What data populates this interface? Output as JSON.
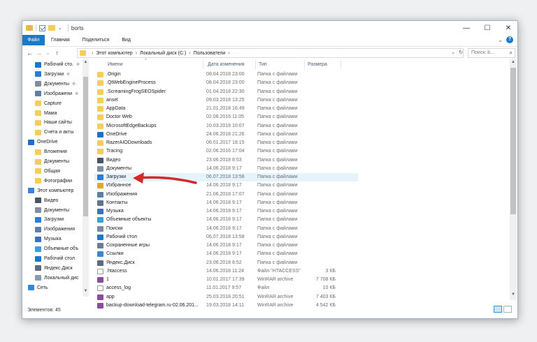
{
  "window": {
    "title": "borts",
    "controls": {
      "minimize": "—",
      "maximize": "☐",
      "close": "✕"
    }
  },
  "ribbon": {
    "tabs": [
      "Файл",
      "Главная",
      "Поделиться",
      "Вид"
    ],
    "expand": "⌄",
    "help": "?"
  },
  "address": {
    "back": "←",
    "forward": "→",
    "recent": "⌄",
    "up": "↑",
    "crumbs": [
      "Этот компьютер",
      "Локальный диск (C:)",
      "Пользователи",
      "·····"
    ],
    "dropdown": "⌄",
    "refresh": "↻",
    "search_placeholder": "Поиск: b...",
    "search_icon": "⌕"
  },
  "navpane": {
    "pin": "✲",
    "items": [
      {
        "label": "Рабочий сто.",
        "icon": "desktop-icon",
        "color": "#1979ca",
        "pinned": true,
        "indent": 1
      },
      {
        "label": "Загрузки",
        "icon": "download-icon",
        "color": "#2c7bd6",
        "pinned": true,
        "indent": 1
      },
      {
        "label": "Документы",
        "icon": "documents-icon",
        "color": "#7f8ea3",
        "pinned": true,
        "indent": 1
      },
      {
        "label": "Изображени",
        "icon": "pictures-icon",
        "color": "#5c7fa8",
        "pinned": true,
        "indent": 1
      },
      {
        "label": "Capture",
        "icon": "folder-icon",
        "color": "#f4ce5c",
        "pinned": false,
        "indent": 1
      },
      {
        "label": "Мама",
        "icon": "folder-icon",
        "color": "#f4ce5c",
        "pinned": false,
        "indent": 1
      },
      {
        "label": "Наши сайты",
        "icon": "folder-icon",
        "color": "#f4ce5c",
        "pinned": false,
        "indent": 1
      },
      {
        "label": "Счета и акты",
        "icon": "folder-icon",
        "color": "#f4ce5c",
        "pinned": false,
        "indent": 1
      },
      {
        "label": "OneDrive",
        "icon": "onedrive-icon",
        "color": "#1e6fc9",
        "pinned": false,
        "indent": 0
      },
      {
        "label": "Вложения",
        "icon": "folder-icon",
        "color": "#f4ce5c",
        "pinned": false,
        "indent": 1
      },
      {
        "label": "Документы",
        "icon": "folder-icon",
        "color": "#f4ce5c",
        "pinned": false,
        "indent": 1
      },
      {
        "label": "Общая",
        "icon": "folder-icon",
        "color": "#f4ce5c",
        "pinned": false,
        "indent": 1
      },
      {
        "label": "Фотографии",
        "icon": "folder-icon",
        "color": "#f4ce5c",
        "pinned": false,
        "indent": 1
      },
      {
        "label": "Этот компьютер",
        "icon": "computer-icon",
        "color": "#3a86d6",
        "pinned": false,
        "indent": 0
      },
      {
        "label": "Видео",
        "icon": "video-icon",
        "color": "#4a5668",
        "pinned": false,
        "indent": 1
      },
      {
        "label": "Документы",
        "icon": "documents-icon",
        "color": "#7f8ea3",
        "pinned": false,
        "indent": 1
      },
      {
        "label": "Загрузки",
        "icon": "download-icon",
        "color": "#2c7bd6",
        "pinned": false,
        "indent": 1
      },
      {
        "label": "Изображения",
        "icon": "pictures-icon",
        "color": "#5c7fa8",
        "pinned": false,
        "indent": 1
      },
      {
        "label": "Музыка",
        "icon": "music-icon",
        "color": "#3a6fc4",
        "pinned": false,
        "indent": 1
      },
      {
        "label": "Объемные объ",
        "icon": "3d-objects-icon",
        "color": "#3aa0d8",
        "pinned": false,
        "indent": 1
      },
      {
        "label": "Рабочий стол",
        "icon": "desktop-icon",
        "color": "#1979ca",
        "pinned": false,
        "indent": 1
      },
      {
        "label": "Яндекс.Диск",
        "icon": "yandex-disk-icon",
        "color": "#5b6b80",
        "pinned": false,
        "indent": 1
      },
      {
        "label": "Локальный дис",
        "icon": "drive-icon",
        "color": "#8a9bb0",
        "pinned": false,
        "indent": 1
      },
      {
        "label": "Сеть",
        "icon": "network-icon",
        "color": "#3a86d6",
        "pinned": false,
        "indent": 0
      }
    ]
  },
  "columns": {
    "name": "Имени",
    "date": "Дата изменения",
    "type": "Тип",
    "size": "Размера",
    "sort_indicator": "^"
  },
  "files": [
    {
      "name": ".Origin",
      "date": "08.04.2018 23:00",
      "type": "Папка с файлами",
      "size": "",
      "icon": "folder-icon",
      "color": "#f4ce5c"
    },
    {
      "name": ".QtWebEngineProcess",
      "date": "08.04.2018 23:00",
      "type": "Папка с файлами",
      "size": "",
      "icon": "folder-icon",
      "color": "#f4ce5c"
    },
    {
      "name": ".ScreamingFrogSEOSpider",
      "date": "01.04.2018 22:30",
      "type": "Папка с файлами",
      "size": "",
      "icon": "folder-icon",
      "color": "#f4ce5c"
    },
    {
      "name": "ansel",
      "date": "09.03.2018 13:25",
      "type": "Папка с файлами",
      "size": "",
      "icon": "folder-icon",
      "color": "#f4ce5c"
    },
    {
      "name": "AppData",
      "date": "21.01.2018 16:49",
      "type": "Папка с файлами",
      "size": "",
      "icon": "folder-icon",
      "color": "#f4ce5c"
    },
    {
      "name": "Doctor Web",
      "date": "02.08.2016 11:05",
      "type": "Папка с файлами",
      "size": "",
      "icon": "folder-icon",
      "color": "#f4ce5c"
    },
    {
      "name": "MicrosoftEdgeBackups",
      "date": "10.03.2018 10:07",
      "type": "Папка с файлами",
      "size": "",
      "icon": "folder-icon",
      "color": "#f4ce5c"
    },
    {
      "name": "OneDrive",
      "date": "24.06.2018 21:26",
      "type": "Папка с файлами",
      "size": "",
      "icon": "onedrive-icon",
      "color": "#1e6fc9"
    },
    {
      "name": "RazerAIODownloads",
      "date": "06.01.2017 18:15",
      "type": "Папка с файлами",
      "size": "",
      "icon": "folder-icon",
      "color": "#f4ce5c"
    },
    {
      "name": "Tracing",
      "date": "02.06.2016 17:04",
      "type": "Папка с файлами",
      "size": "",
      "icon": "folder-icon",
      "color": "#f4ce5c"
    },
    {
      "name": "Видео",
      "date": "23.06.2018 8:53",
      "type": "Папка с файлами",
      "size": "",
      "icon": "video-icon",
      "color": "#4a5668"
    },
    {
      "name": "Документы",
      "date": "14.06.2018 9:17",
      "type": "Папка с файлами",
      "size": "",
      "icon": "documents-icon",
      "color": "#7f8ea3"
    },
    {
      "name": "Загрузки",
      "date": "06.07.2018 13:58",
      "type": "Папка с файлами",
      "size": "",
      "icon": "download-icon",
      "color": "#2c7bd6",
      "selected": true
    },
    {
      "name": "Избранное",
      "date": "14.06.2018 9:17",
      "type": "Папка с файлами",
      "size": "",
      "icon": "favorites-icon",
      "color": "#e8a626"
    },
    {
      "name": "Изображения",
      "date": "21.06.2018 17:07",
      "type": "Папка с файлами",
      "size": "",
      "icon": "pictures-icon",
      "color": "#5c7fa8"
    },
    {
      "name": "Контакты",
      "date": "14.06.2018 9:17",
      "type": "Папка с файлами",
      "size": "",
      "icon": "contacts-icon",
      "color": "#5d7390"
    },
    {
      "name": "Музыка",
      "date": "14.06.2018 9:17",
      "type": "Папка с файлами",
      "size": "",
      "icon": "music-icon",
      "color": "#3a6fc4"
    },
    {
      "name": "Объемные объекты",
      "date": "14.06.2018 9:17",
      "type": "Папка с файлами",
      "size": "",
      "icon": "3d-objects-icon",
      "color": "#3aa0d8"
    },
    {
      "name": "Поиски",
      "date": "14.06.2018 9:17",
      "type": "Папка с файлами",
      "size": "",
      "icon": "search-folder-icon",
      "color": "#7a8aa0"
    },
    {
      "name": "Рабочий стол",
      "date": "06.07.2018 13:58",
      "type": "Папка с файлами",
      "size": "",
      "icon": "desktop-icon",
      "color": "#1979ca"
    },
    {
      "name": "Сохраненные игры",
      "date": "14.06.2018 9:17",
      "type": "Папка с файлами",
      "size": "",
      "icon": "saved-games-icon",
      "color": "#6a7d95"
    },
    {
      "name": "Ссылки",
      "date": "14.06.2018 9:17",
      "type": "Папка с файлами",
      "size": "",
      "icon": "links-icon",
      "color": "#3a86d6"
    },
    {
      "name": "Яндекс.Диск",
      "date": "23.06.2018 8:52",
      "type": "Папка с файлами",
      "size": "",
      "icon": "yandex-disk-icon",
      "color": "#5b6b80"
    },
    {
      "name": ".htaccess",
      "date": "14.06.2018 11:24",
      "type": "Файл \"HTACCESS\"",
      "size": "3 КБ",
      "icon": "file-icon",
      "color": "#ffffff"
    },
    {
      "name": "1",
      "date": "10.01.2017 17:39",
      "type": "WinRAR archive",
      "size": "7 708 КБ",
      "icon": "archive-icon",
      "color": "#8a4a9e"
    },
    {
      "name": "access_log",
      "date": "11.01.2017 9:57",
      "type": "Файл",
      "size": "10 КБ",
      "icon": "file-icon",
      "color": "#ffffff"
    },
    {
      "name": "app",
      "date": "25.03.2018 20:51",
      "type": "WinRAR archive",
      "size": "7 403 КБ",
      "icon": "archive-icon",
      "color": "#8a4a9e"
    },
    {
      "name": "backup-download-telegram.ru-02.06.201...",
      "date": "19.03.2018 14:11",
      "type": "WinRAR archive",
      "size": "4 542 КБ",
      "icon": "archive-icon",
      "color": "#8a4a9e"
    }
  ],
  "status": {
    "count": "Элементов: 45"
  },
  "accent": "#1979ca",
  "annotation_arrow_color": "#d42a2a"
}
